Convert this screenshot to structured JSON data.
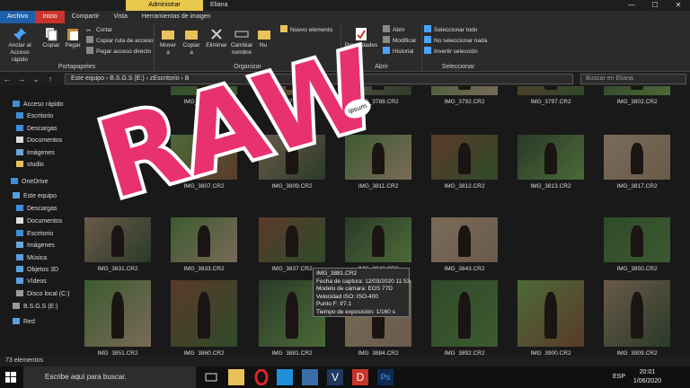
{
  "window": {
    "manage_label": "Administrar",
    "name": "Eliana",
    "minimize": "—",
    "maximize": "☐",
    "close": "✕"
  },
  "tabs": [
    "Archivo",
    "Inicio",
    "Compartir",
    "Vista",
    "Herramientas de imagen"
  ],
  "ribbon": {
    "pin_label": "Anclar al Acceso rápido",
    "copy_label": "Copiar",
    "paste_label": "Pegar",
    "cut_label": "Cortar",
    "copy_path_label": "Copiar ruta de acceso",
    "paste_shortcut_label": "Pegar acceso directo",
    "clipboard_group": "Portapapeles",
    "move_label": "Mover a",
    "copy_to_label": "Copiar a",
    "delete_label": "Eliminar",
    "rename_label": "Cambiar nombre",
    "new_folder_label": "Nu",
    "new_item_label": "Nuevo elemento",
    "organize_group": "Organizar",
    "properties_label": "Propiedades",
    "open_label": "Abrir",
    "edit_label": "Modificar",
    "history_label": "Historial",
    "open_group": "Abrir",
    "select_all_label": "Seleccionar todo",
    "select_none_label": "No seleccionar nada",
    "invert_label": "Invertir selección",
    "select_group": "Seleccionar"
  },
  "address": {
    "path": "Este equipo  ›  B.S.G.S (E:)  ›  zEscritorio  ›  B",
    "search_placeholder": "Buscar en Eliana"
  },
  "sidebar": {
    "items": [
      {
        "label": "Acceso rápido",
        "color": "#3f8fd8"
      },
      {
        "label": "Escritorio",
        "color": "#3f8fd8"
      },
      {
        "label": "Descargas",
        "color": "#3f8fd8"
      },
      {
        "label": "Documentos",
        "color": "#dddddd"
      },
      {
        "label": "Imágenes",
        "color": "#6aa6d8"
      },
      {
        "label": "studio",
        "color": "#e8c15a"
      },
      {
        "label": "OneDrive",
        "color": "#3f8fd8"
      },
      {
        "label": "Este equipo",
        "color": "#5aa0e0"
      },
      {
        "label": "Descargas",
        "color": "#3f8fd8"
      },
      {
        "label": "Documentos",
        "color": "#dddddd"
      },
      {
        "label": "Escritorio",
        "color": "#3f8fd8"
      },
      {
        "label": "Imágenes",
        "color": "#6aa6d8"
      },
      {
        "label": "Música",
        "color": "#5aa0e0"
      },
      {
        "label": "Objetos 3D",
        "color": "#5aa0e0"
      },
      {
        "label": "Vídeos",
        "color": "#5aa0e0"
      },
      {
        "label": "Disco local (C:)",
        "color": "#999999"
      },
      {
        "label": "B.S.G.S (E:)",
        "color": "#999999"
      },
      {
        "label": "Red",
        "color": "#5aa0e0"
      }
    ]
  },
  "files": {
    "row0": [
      "IMG_3778.CR2",
      "IMG_3779.CR2",
      "IMG_3788.CR2",
      "IMG_3792.CR2",
      "IMG_3797.CR2",
      "IMG_3802.CR2"
    ],
    "row1": [
      "IMG_3807.CR2",
      "IMG_3809.CR2",
      "IMG_3811.CR2",
      "IMG_3812.CR2",
      "IMG_3813.CR2",
      "IMG_3817.CR2"
    ],
    "row2": [
      "IMG_3831.CR2",
      "IMG_3833.CR2",
      "IMG_3837.CR2",
      "IMG_3842.CR2",
      "IMG_3843.CR2",
      "IMG_3850.CR2"
    ],
    "row3": [
      "IMG_3851.CR2",
      "IMG_3860.CR2",
      "IMG_3881.CR2",
      "IMG_3884.CR2",
      "IMG_3892.CR2",
      "IMG_3900.CR2",
      "IMG_3909.CR2"
    ]
  },
  "tooltip": {
    "name": "IMG_3881.CR2",
    "date": "Fecha de captura: 12/03/2020 11:53",
    "model": "Modelo de cámara: EOS 77D",
    "iso": "Velocidad ISO: ISO-400",
    "fstop": "Punto F: f/7.1",
    "exposure": "Tiempo de exposición: 1/160 s"
  },
  "overlay": {
    "raw_text": "RAW",
    "ipsum_text": "ipsum"
  },
  "status": {
    "count": "73 elementos"
  },
  "taskbar": {
    "search_placeholder": "Escribe aquí para buscar.",
    "lang": "ESP",
    "time": "20:01",
    "date": "1/06/2020"
  },
  "colors": {
    "accent_red": "#c9342c",
    "raw_pink": "#e8326f",
    "raw_purple": "#8a2aa8",
    "manage_yellow": "#e8c84c"
  }
}
